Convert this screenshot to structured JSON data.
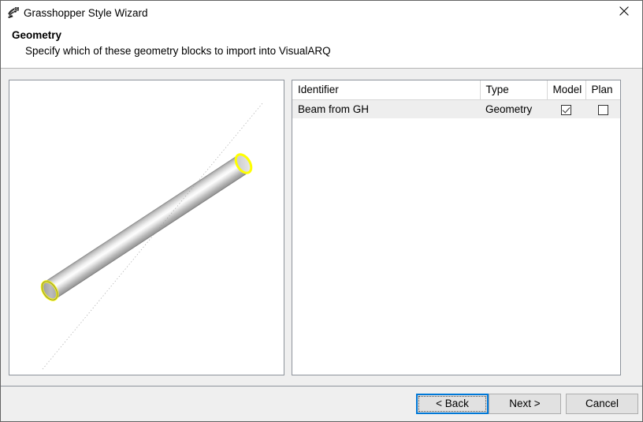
{
  "window": {
    "title": "Grasshopper Style Wizard",
    "icon": "grasshopper-icon",
    "close_label": "✕"
  },
  "header": {
    "title": "Geometry",
    "subtitle": "Specify which of these geometry blocks to import into VisualARQ"
  },
  "preview": {
    "name": "geometry-preview",
    "object": "beam-cylinder",
    "edge_highlight_color": "#ffff00",
    "surface_color_light": "#fbfbfb",
    "surface_color_dark": "#9d9d9d",
    "background": "#ffffff"
  },
  "table": {
    "columns": [
      "Identifier",
      "Type",
      "Model",
      "Plan"
    ],
    "rows": [
      {
        "identifier": "Beam from GH",
        "type": "Geometry",
        "model": true,
        "plan": false
      }
    ]
  },
  "footer": {
    "back_label": "< Back",
    "next_label": "Next >",
    "cancel_label": "Cancel"
  },
  "colors": {
    "accent": "#0078d7",
    "dialog_bg": "#efefef",
    "panel_bg": "#ffffff",
    "border": "#8d939b",
    "row_bg": "#eeeeee"
  }
}
